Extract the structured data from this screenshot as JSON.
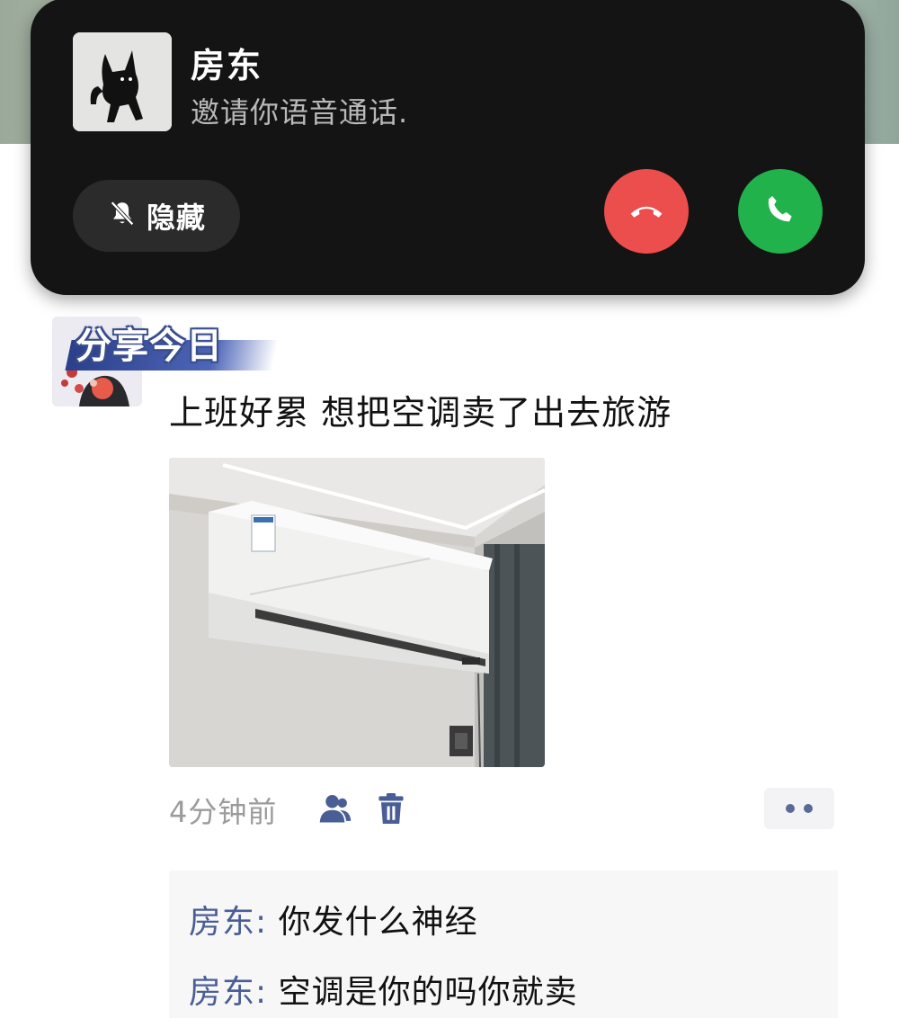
{
  "call": {
    "caller_name": "房东",
    "status_text": "邀请你语音通话.",
    "hide_label": "隐藏",
    "icons": {
      "mute": "bell-off-icon",
      "decline": "phone-hangup-icon",
      "accept": "phone-icon"
    },
    "colors": {
      "decline": "#ec4d4d",
      "accept": "#22b24c",
      "banner": "#141414"
    }
  },
  "post": {
    "avatar_caption": "分享今日",
    "text": "上班好累  想把空调卖了出去旅游",
    "image_alt": "wall-mounted air conditioner",
    "time": "4分钟前",
    "icons": {
      "visibility": "people-icon",
      "delete": "trash-icon",
      "more": "more-icon"
    }
  },
  "comments": [
    {
      "author": "房东",
      "separator": ": ",
      "text": "你发什么神经"
    },
    {
      "author": "房东",
      "separator": ": ",
      "text": "空调是你的吗你就卖"
    }
  ]
}
